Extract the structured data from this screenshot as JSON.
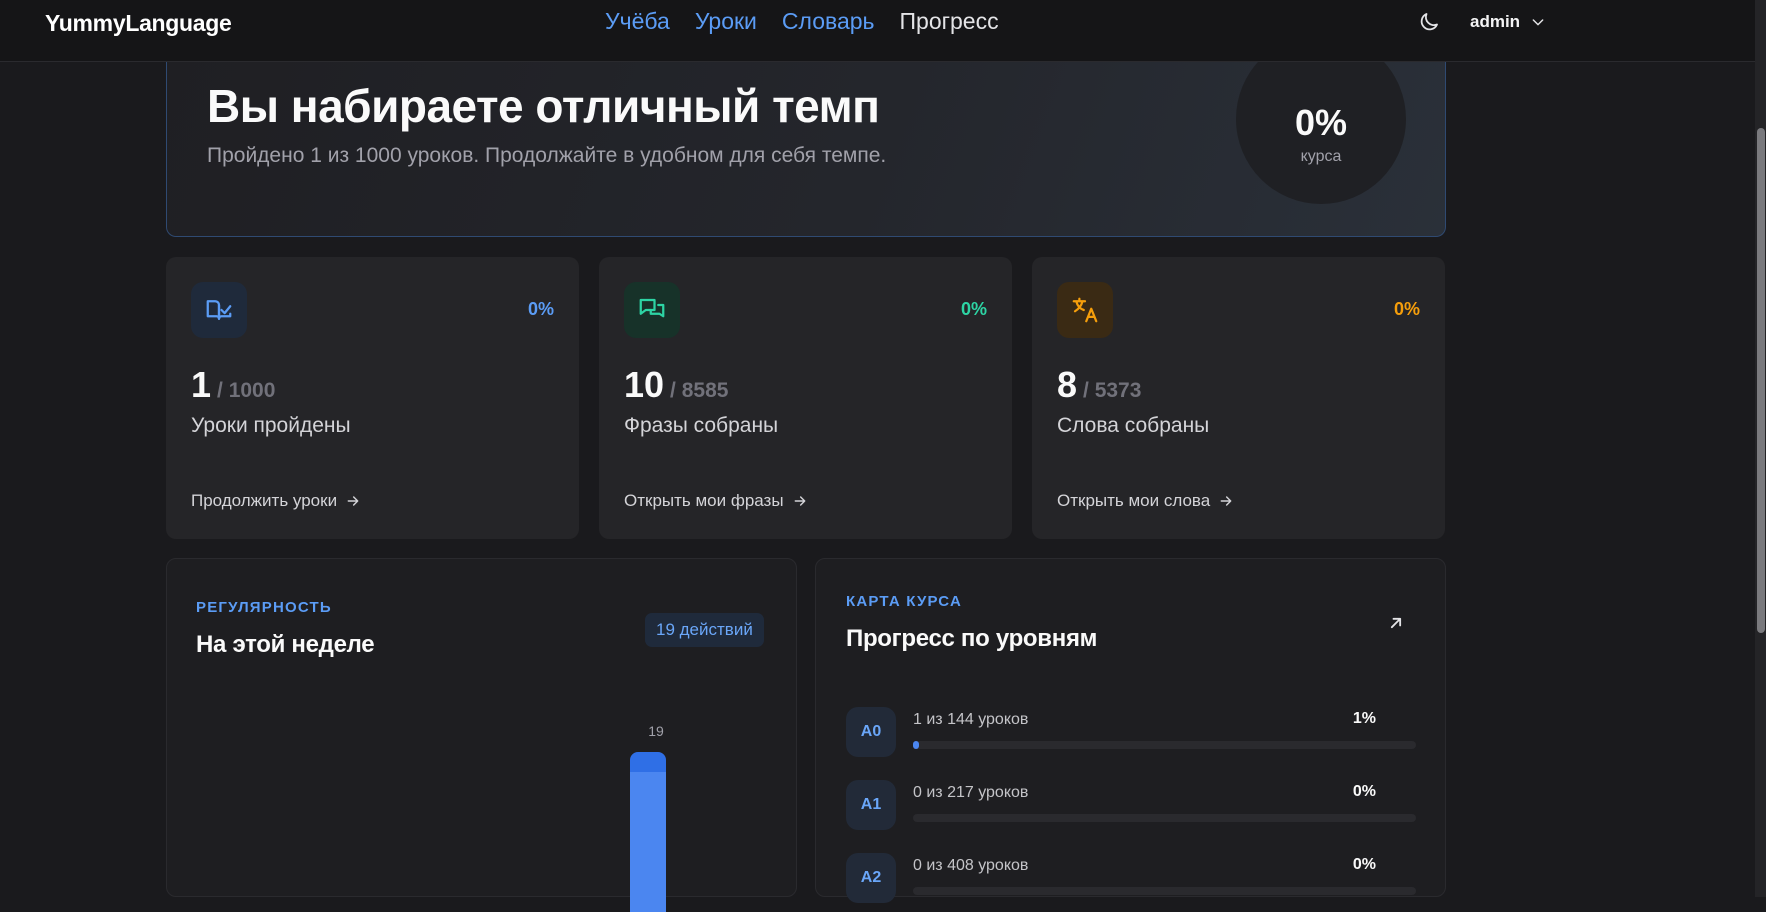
{
  "header": {
    "logo": "YummyLanguage",
    "nav": [
      {
        "label": "Учёба",
        "active": false
      },
      {
        "label": "Уроки",
        "active": false
      },
      {
        "label": "Словарь",
        "active": false
      },
      {
        "label": "Прогресс",
        "active": true
      }
    ],
    "user": "admin"
  },
  "hero": {
    "title": "Вы набираете отличный темп",
    "subtitle": "Пройдено 1 из 1000 уроков. Продолжайте в удобном для себя темпе.",
    "percent": "0%",
    "percent_label": "курса"
  },
  "stats": [
    {
      "value": "1",
      "total": "/ 1000",
      "label": "Уроки пройдены",
      "percent": "0%",
      "link": "Продолжить уроки",
      "icon": "book-check-icon",
      "color": "#5b9cf5"
    },
    {
      "value": "10",
      "total": "/ 8585",
      "label": "Фразы собраны",
      "percent": "0%",
      "link": "Открыть мои фразы",
      "icon": "chat-bubbles-icon",
      "color": "#2dd4a4"
    },
    {
      "value": "8",
      "total": "/ 5373",
      "label": "Слова собраны",
      "percent": "0%",
      "link": "Открыть мои слова",
      "icon": "translate-icon",
      "color": "#f59e0b"
    }
  ],
  "regularity": {
    "eyebrow": "РЕГУЛЯРНОСТЬ",
    "title": "На этой неделе",
    "badge": "19 действий",
    "bar_value": "19"
  },
  "course_map": {
    "eyebrow": "КАРТА КУРСА",
    "title": "Прогресс по уровням",
    "levels": [
      {
        "code": "A0",
        "text": "1 из 144 уроков",
        "percent": "1%",
        "fill": 0.01
      },
      {
        "code": "A1",
        "text": "0 из 217 уроков",
        "percent": "0%",
        "fill": 0
      },
      {
        "code": "A2",
        "text": "0 из 408 уроков",
        "percent": "0%",
        "fill": 0
      }
    ]
  },
  "colors": {
    "accent": "#5b9cf5",
    "green": "#2dd4a4",
    "orange": "#f59e0b"
  }
}
